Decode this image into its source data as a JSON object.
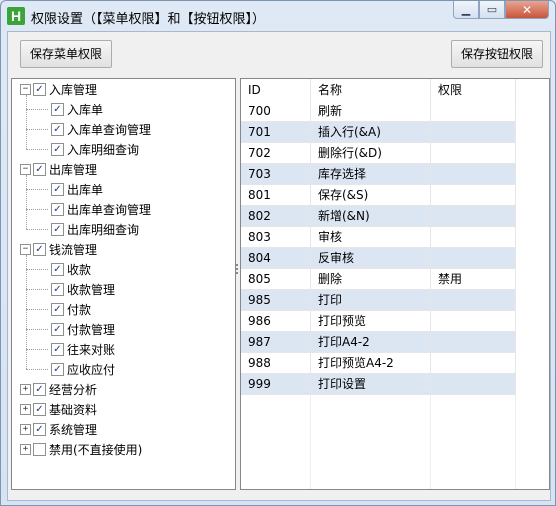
{
  "window": {
    "title": "权限设置（【菜单权限】和【按钮权限】）",
    "icon": "app-logo-icon",
    "app_icon_letter": "H",
    "controls": {
      "minimize": "minimize-icon",
      "maximize": "maximize-icon",
      "close": "close-icon"
    }
  },
  "toolbar": {
    "save_menu_label": "保存菜单权限",
    "save_button_label": "保存按钮权限"
  },
  "tree": {
    "nodes": [
      {
        "label": "入库管理",
        "level": 0,
        "expanded": true,
        "checked": true
      },
      {
        "label": "入库单",
        "level": 1,
        "checked": true
      },
      {
        "label": "入库单查询管理",
        "level": 1,
        "checked": true
      },
      {
        "label": "入库明细查询",
        "level": 1,
        "checked": true
      },
      {
        "label": "出库管理",
        "level": 0,
        "expanded": true,
        "checked": true
      },
      {
        "label": "出库单",
        "level": 1,
        "checked": true
      },
      {
        "label": "出库单查询管理",
        "level": 1,
        "checked": true
      },
      {
        "label": "出库明细查询",
        "level": 1,
        "checked": true
      },
      {
        "label": "钱流管理",
        "level": 0,
        "expanded": true,
        "checked": true
      },
      {
        "label": "收款",
        "level": 1,
        "checked": true
      },
      {
        "label": "收款管理",
        "level": 1,
        "checked": true
      },
      {
        "label": "付款",
        "level": 1,
        "checked": true
      },
      {
        "label": "付款管理",
        "level": 1,
        "checked": true
      },
      {
        "label": "往来对账",
        "level": 1,
        "checked": true
      },
      {
        "label": "应收应付",
        "level": 1,
        "checked": true
      },
      {
        "label": "经营分析",
        "level": 0,
        "expanded": false,
        "checked": true
      },
      {
        "label": "基础资料",
        "level": 0,
        "expanded": false,
        "checked": true
      },
      {
        "label": "系统管理",
        "level": 0,
        "expanded": false,
        "checked": true
      },
      {
        "label": "禁用(不直接使用)",
        "level": 0,
        "expanded": false,
        "checked": false
      }
    ]
  },
  "grid": {
    "columns": [
      "ID",
      "名称",
      "权限"
    ],
    "rows": [
      {
        "id": "700",
        "name": "刷新",
        "perm": ""
      },
      {
        "id": "701",
        "name": "插入行(&A)",
        "perm": ""
      },
      {
        "id": "702",
        "name": "删除行(&D)",
        "perm": ""
      },
      {
        "id": "703",
        "name": "库存选择",
        "perm": ""
      },
      {
        "id": "801",
        "name": "保存(&S)",
        "perm": ""
      },
      {
        "id": "802",
        "name": "新增(&N)",
        "perm": ""
      },
      {
        "id": "803",
        "name": "审核",
        "perm": ""
      },
      {
        "id": "804",
        "name": "反审核",
        "perm": ""
      },
      {
        "id": "805",
        "name": "删除",
        "perm": "禁用"
      },
      {
        "id": "985",
        "name": "打印",
        "perm": ""
      },
      {
        "id": "986",
        "name": "打印预览",
        "perm": ""
      },
      {
        "id": "987",
        "name": "打印A4-2",
        "perm": ""
      },
      {
        "id": "988",
        "name": "打印预览A4-2",
        "perm": ""
      },
      {
        "id": "999",
        "name": "打印设置",
        "perm": ""
      }
    ]
  },
  "colors": {
    "row_highlight": "#dce6f3",
    "app_icon": "#3aa33a",
    "close_button": "#c7553b"
  }
}
